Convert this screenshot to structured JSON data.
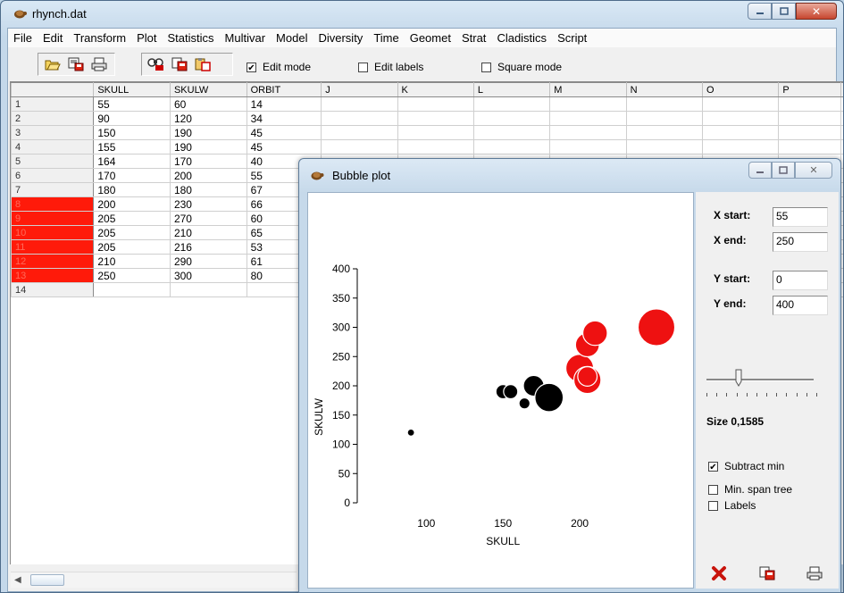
{
  "window": {
    "title": "rhynch.dat",
    "icon": "turtle-icon"
  },
  "menu": [
    "File",
    "Edit",
    "Transform",
    "Plot",
    "Statistics",
    "Multivar",
    "Model",
    "Diversity",
    "Time",
    "Geomet",
    "Strat",
    "Cladistics",
    "Script"
  ],
  "toolbar": {
    "icons": [
      "open-folder-icon",
      "save-icon",
      "print-icon",
      "find-replace-icon",
      "copy-icon",
      "paste-icon"
    ],
    "edit_mode": {
      "label": "Edit mode",
      "checked": true
    },
    "edit_labels": {
      "label": "Edit labels",
      "checked": false
    },
    "square_mode": {
      "label": "Square mode",
      "checked": false
    }
  },
  "sheet": {
    "columns": [
      "SKULL",
      "SKULW",
      "ORBIT",
      "J",
      "K",
      "L",
      "M",
      "N",
      "O",
      "P"
    ],
    "rows": [
      {
        "label": "1",
        "selected": false,
        "cells": [
          "55",
          "60",
          "14"
        ]
      },
      {
        "label": "2",
        "selected": false,
        "cells": [
          "90",
          "120",
          "34"
        ]
      },
      {
        "label": "3",
        "selected": false,
        "cells": [
          "150",
          "190",
          "45"
        ]
      },
      {
        "label": "4",
        "selected": false,
        "cells": [
          "155",
          "190",
          "45"
        ]
      },
      {
        "label": "5",
        "selected": false,
        "cells": [
          "164",
          "170",
          "40"
        ]
      },
      {
        "label": "6",
        "selected": false,
        "cells": [
          "170",
          "200",
          "55"
        ]
      },
      {
        "label": "7",
        "selected": false,
        "cells": [
          "180",
          "180",
          "67"
        ]
      },
      {
        "label": "8",
        "selected": true,
        "cells": [
          "200",
          "230",
          "66"
        ]
      },
      {
        "label": "9",
        "selected": true,
        "cells": [
          "205",
          "270",
          "60"
        ]
      },
      {
        "label": "10",
        "selected": true,
        "cells": [
          "205",
          "210",
          "65"
        ]
      },
      {
        "label": "11",
        "selected": true,
        "cells": [
          "205",
          "216",
          "53"
        ]
      },
      {
        "label": "12",
        "selected": true,
        "cells": [
          "210",
          "290",
          "61"
        ]
      },
      {
        "label": "13",
        "selected": true,
        "cells": [
          "250",
          "300",
          "80"
        ]
      },
      {
        "label": "14",
        "selected": false,
        "cells": [
          "",
          "",
          ""
        ]
      }
    ]
  },
  "dialog": {
    "title": "Bubble plot",
    "icon": "turtle-icon",
    "x_start_label": "X start:",
    "x_start": "55",
    "x_end_label": "X end:",
    "x_end": "250",
    "y_start_label": "Y start:",
    "y_start": "0",
    "y_end_label": "Y end:",
    "y_end": "400",
    "size_label": "Size 0,1585",
    "slider_fraction": 0.3,
    "subtract_min": {
      "label": "Subtract min",
      "checked": true
    },
    "min_span_tree": {
      "label": "Min. span tree",
      "checked": false
    },
    "labels": {
      "label": "Labels",
      "checked": false
    },
    "buttons": [
      "close-x-icon",
      "copy-icon",
      "print-icon"
    ]
  },
  "chart_data": {
    "type": "scatter",
    "subtype": "bubble",
    "xlabel": "SKULL",
    "ylabel": "SKULW",
    "xlim": [
      55,
      250
    ],
    "ylim": [
      0,
      400
    ],
    "xticks": [
      100,
      150,
      200
    ],
    "yticks": [
      0,
      50,
      100,
      150,
      200,
      250,
      300,
      350,
      400
    ],
    "grid": false,
    "colors": {
      "default": "#000000",
      "selected": "#ee1111"
    },
    "points": [
      {
        "x": 90,
        "y": 120,
        "size": 34,
        "color": "black"
      },
      {
        "x": 150,
        "y": 190,
        "size": 45,
        "color": "black"
      },
      {
        "x": 155,
        "y": 190,
        "size": 45,
        "color": "black"
      },
      {
        "x": 164,
        "y": 170,
        "size": 40,
        "color": "black"
      },
      {
        "x": 170,
        "y": 200,
        "size": 55,
        "color": "black"
      },
      {
        "x": 180,
        "y": 180,
        "size": 67,
        "color": "black"
      },
      {
        "x": 200,
        "y": 230,
        "size": 66,
        "color": "red"
      },
      {
        "x": 205,
        "y": 270,
        "size": 60,
        "color": "red"
      },
      {
        "x": 205,
        "y": 210,
        "size": 65,
        "color": "red"
      },
      {
        "x": 205,
        "y": 216,
        "size": 53,
        "color": "red"
      },
      {
        "x": 210,
        "y": 290,
        "size": 61,
        "color": "red"
      },
      {
        "x": 250,
        "y": 300,
        "size": 80,
        "color": "red"
      }
    ]
  }
}
